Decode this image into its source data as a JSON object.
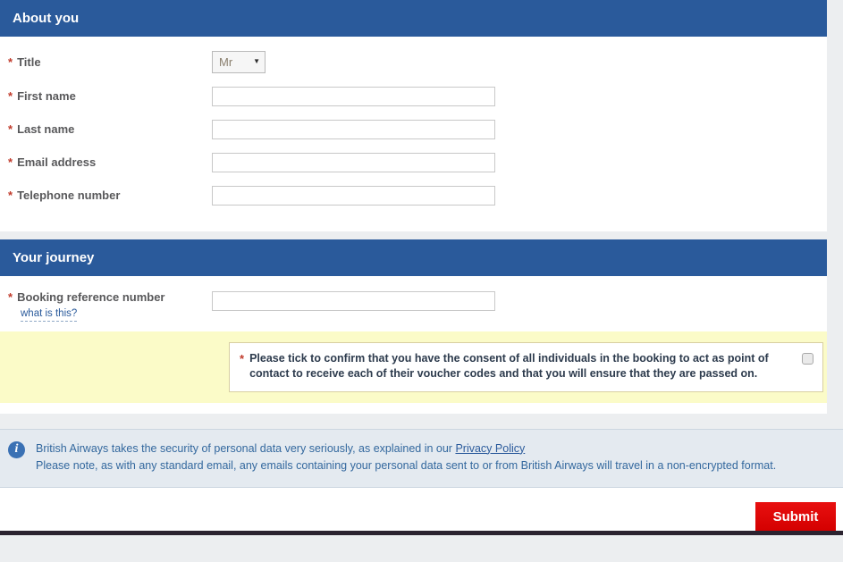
{
  "sections": [
    {
      "title": "About you",
      "fields": [
        {
          "label": "Title",
          "required_marker": "*",
          "control": "select",
          "value": "Mr",
          "caret": "▼"
        },
        {
          "label": "First name",
          "required_marker": "*",
          "control": "text",
          "value": "",
          "placeholder": ""
        },
        {
          "label": "Last name",
          "required_marker": "*",
          "control": "text",
          "value": "",
          "placeholder": ""
        },
        {
          "label": "Email address",
          "required_marker": "*",
          "control": "text",
          "value": "",
          "placeholder": ""
        },
        {
          "label": "Telephone number",
          "required_marker": "*",
          "control": "text",
          "value": "",
          "placeholder": ""
        }
      ]
    },
    {
      "title": "Your journey",
      "booking": {
        "label": "Booking reference number",
        "required_marker": "*",
        "help_link": "what is this?",
        "value": "",
        "placeholder": ""
      }
    }
  ],
  "consent": {
    "required_marker": "*",
    "text": "Please tick to confirm that you have the consent of all individuals in the booking to act as point of contact to receive each of their voucher codes and that you will ensure that they are passed on.",
    "checked": false
  },
  "privacy": {
    "icon": "info-icon",
    "icon_glyph": "i",
    "line1_before_link": "British Airways takes the security of personal data very seriously, as explained in our",
    "link_text": "Privacy Policy",
    "line2": "Please note, as with any standard email, any emails containing your personal data sent to or from British Airways will travel in a non-encrypted format."
  },
  "actions": {
    "submit_label": "Submit"
  },
  "colors": {
    "section_header_bg": "#2a5a9b",
    "page_bg": "#eceef0",
    "consent_band_bg": "#fbfbc8",
    "privacy_bg": "#e4eaf0",
    "submit_bg": "#e00000",
    "required_star": "#c03a2b",
    "link": "#2a5a9b"
  }
}
